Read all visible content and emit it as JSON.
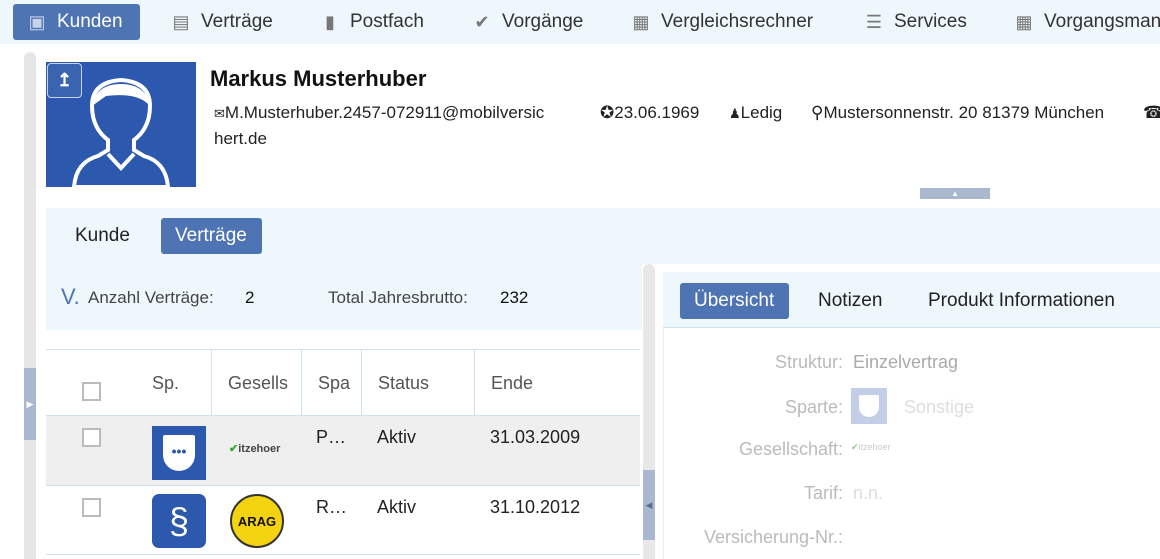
{
  "nav": {
    "items": [
      {
        "label": "Kunden",
        "icon": "contact-card-icon",
        "active": true
      },
      {
        "label": "Verträge",
        "icon": "documents-icon"
      },
      {
        "label": "Postfach",
        "icon": "mailbox-icon"
      },
      {
        "label": "Vorgänge",
        "icon": "check-circle-icon"
      },
      {
        "label": "Vergleichsrechner",
        "icon": "building-icon"
      },
      {
        "label": "Services",
        "icon": "list-icon"
      },
      {
        "label": "Vorgangsmanager",
        "icon": "building-icon"
      }
    ]
  },
  "customer": {
    "name": "Markus Musterhuber",
    "email": "M.Musterhuber.2457-072911@mobilversic",
    "email_cont": "hert.de",
    "birthdate": "23.06.1969",
    "status": "Ledig",
    "address": "Mustersonnenstr. 20 81379 München"
  },
  "tabs": {
    "kunde": "Kunde",
    "vertraege": "Verträge"
  },
  "summary": {
    "prefix": "V.",
    "count_label": "Anzahl Verträge:",
    "count": "2",
    "total_label": "Total Jahresbrutto:",
    "total": "232"
  },
  "table": {
    "headers": [
      "Sp.",
      "Gesells",
      "Spa",
      "Status",
      "Ende"
    ],
    "rows": [
      {
        "sparte": "P…",
        "company_logo": "itzehoer",
        "status": "Aktiv",
        "ende": "31.03.2009",
        "sparte_icon": "shield-icon"
      },
      {
        "sparte": "R…",
        "company_logo": "ARAG",
        "status": "Aktiv",
        "ende": "31.10.2012",
        "sparte_icon": "paragraph-icon"
      }
    ]
  },
  "detail": {
    "tabs": [
      "Übersicht",
      "Notizen",
      "Produkt Informationen"
    ],
    "fields": {
      "struktur_label": "Struktur:",
      "struktur": "Einzelvertrag",
      "sparte_label": "Sparte:",
      "sparte": "Sonstige",
      "gesellschaft_label": "Gesellschaft:",
      "tarif_label": "Tarif:",
      "tarif": "n.n.",
      "versnr_label": "Versicherung-Nr.:"
    }
  },
  "colors": {
    "accent": "#4e74b4",
    "photo_bg": "#2c59ad"
  }
}
